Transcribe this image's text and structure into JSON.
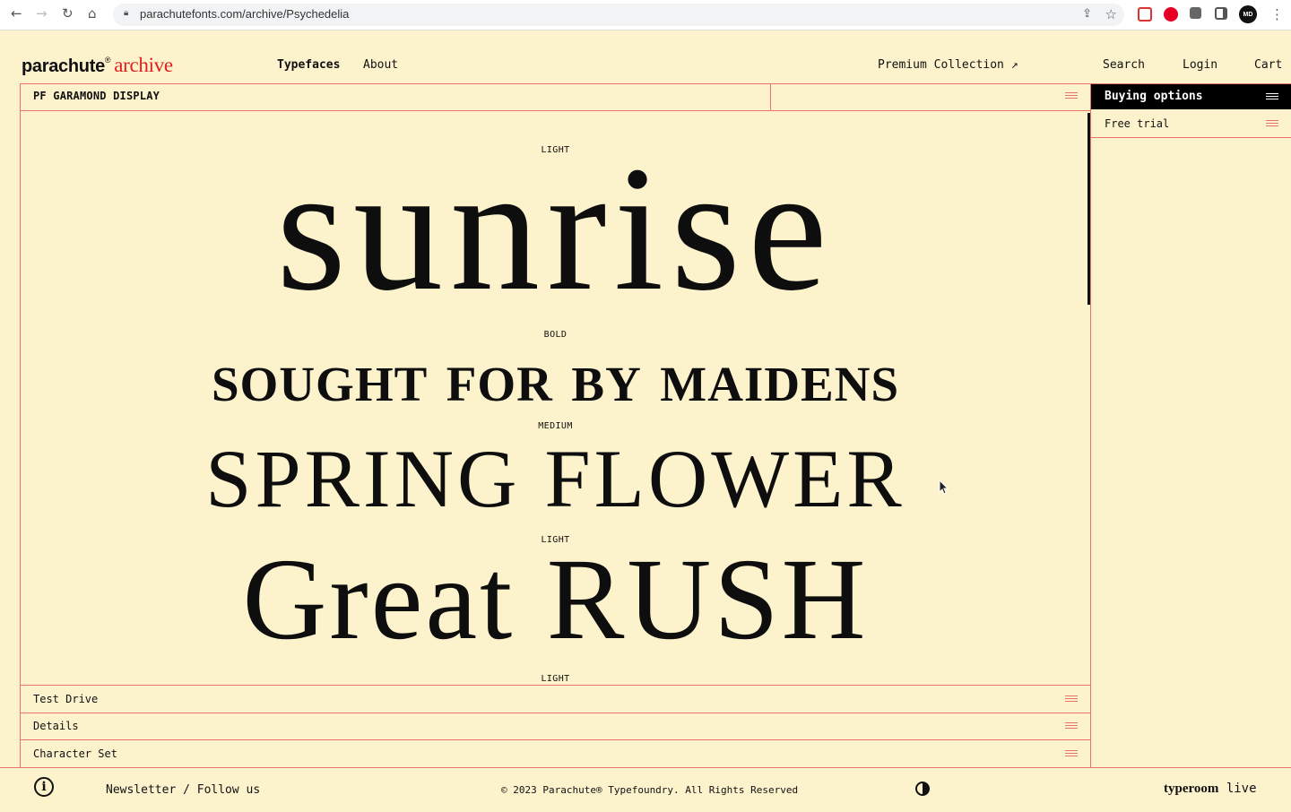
{
  "browser": {
    "url": "parachutefonts.com/archive/Psychedelia",
    "profile_initials": "MD"
  },
  "header": {
    "logo_main": "parachute",
    "logo_reg": "®",
    "logo_archive": "archive",
    "nav": {
      "typefaces": "Typefaces",
      "about": "About",
      "premium": "Premium Collection ↗",
      "search": "Search",
      "login": "Login",
      "cart": "Cart"
    }
  },
  "product": {
    "title": "PF GARAMOND DISPLAY"
  },
  "buying": {
    "title": "Buying options",
    "free_trial": "Free trial"
  },
  "specimen": {
    "lines": [
      {
        "weight": "LIGHT",
        "text": "sunrise"
      },
      {
        "weight": "BOLD",
        "text": "sought for by maidens"
      },
      {
        "weight": "MEDIUM",
        "text": "SPRING FLOWER"
      },
      {
        "weight": "LIGHT",
        "text": "Great RUSH"
      },
      {
        "weight": "LIGHT",
        "text": ""
      }
    ]
  },
  "accordions": {
    "test_drive": "Test Drive",
    "details": "Details",
    "character_set": "Character Set"
  },
  "footer": {
    "newsletter": "Newsletter / Follow us",
    "copyright": "© 2023 Parachute® Typefoundry. All Rights Reserved",
    "typeroom_bold": "typeroom",
    "typeroom_light": "live"
  },
  "colors": {
    "background": "#fcf2cc",
    "accent_red": "#e02020",
    "rule": "#e8736b"
  }
}
